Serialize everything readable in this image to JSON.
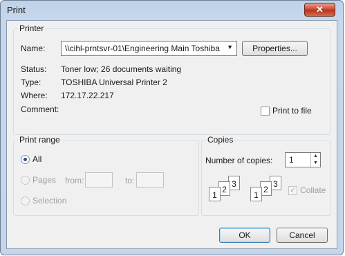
{
  "window": {
    "title": "Print",
    "close_glyph": "✕"
  },
  "printer": {
    "group_label": "Printer",
    "name_label": "Name:",
    "name_value": "\\\\cihl-prntsvr-01\\Engineering Main Toshiba",
    "properties_label": "Properties...",
    "status_label": "Status:",
    "status_value": "Toner low; 26 documents waiting",
    "type_label": "Type:",
    "type_value": "TOSHIBA Universal Printer 2",
    "where_label": "Where:",
    "where_value": "172.17.22.217",
    "comment_label": "Comment:",
    "comment_value": "",
    "print_to_file_label": "Print to file"
  },
  "print_range": {
    "group_label": "Print range",
    "all_label": "All",
    "pages_label": "Pages",
    "from_label": "from:",
    "to_label": "to:",
    "selection_label": "Selection"
  },
  "copies": {
    "group_label": "Copies",
    "number_label": "Number of copies:",
    "number_value": "1",
    "collate_label": "Collate",
    "collate_icon_digits": [
      "1",
      "2",
      "3"
    ]
  },
  "footer": {
    "ok_label": "OK",
    "cancel_label": "Cancel"
  }
}
